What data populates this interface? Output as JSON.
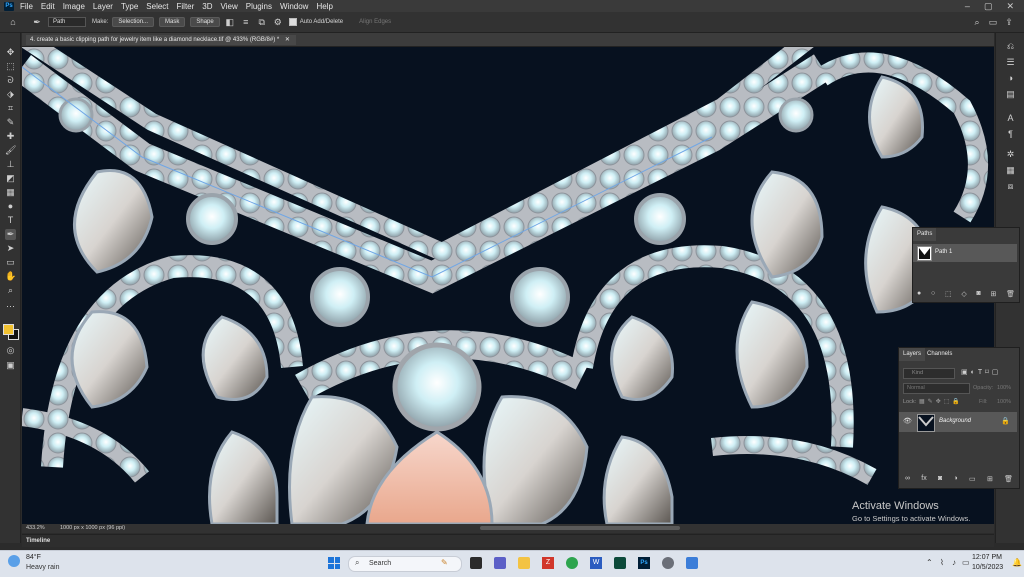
{
  "app": {
    "logo": "Ps",
    "menu": [
      "File",
      "Edit",
      "Image",
      "Layer",
      "Type",
      "Select",
      "Filter",
      "3D",
      "View",
      "Plugins",
      "Window",
      "Help"
    ]
  },
  "options": {
    "mode": "Path",
    "make_label": "Make:",
    "selection_btn": "Selection...",
    "mask_btn": "Mask",
    "shape_btn": "Shape",
    "auto_add": "Auto Add/Delete",
    "align_edges": "Align Edges"
  },
  "document": {
    "tab_title": "4. create a basic clipping path for jewelry item like a diamond necklace.tif @ 433% (RGB/8#) *"
  },
  "status": {
    "zoom": "433.2%",
    "doc_info": "1000 px x 1000 px (96 ppi)"
  },
  "timeline": {
    "label": "Timeline"
  },
  "paths_panel": {
    "tab": "Paths",
    "items": [
      {
        "name": "Path 1"
      }
    ]
  },
  "layers_panel": {
    "tabs": [
      "Layers",
      "Channels"
    ],
    "search_placeholder": "Kind",
    "blend_mode": "Normal",
    "opacity_label": "Opacity:",
    "opacity": "100%",
    "lock_label": "Lock:",
    "fill_label": "Fill:",
    "fill": "100%",
    "layers": [
      {
        "name": "Background",
        "visible": true,
        "locked": true
      }
    ]
  },
  "watermark": {
    "title": "Activate Windows",
    "subtitle": "Go to Settings to activate Windows."
  },
  "taskbar": {
    "weather_temp": "84°F",
    "weather_desc": "Heavy rain",
    "search_placeholder": "Search",
    "time": "12:07 PM",
    "date": "10/5/2023"
  },
  "colors": {
    "foreground": "#f2c230",
    "background": "#111111",
    "canvas_bg": "#07111f",
    "accent": "#31a8ff"
  }
}
